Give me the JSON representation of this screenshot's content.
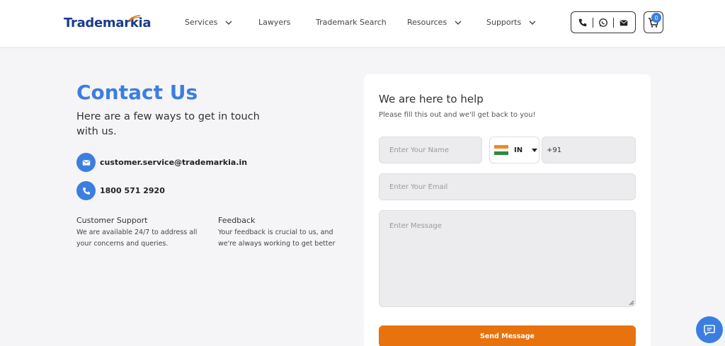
{
  "header": {
    "logo_text": "Trademarkia",
    "nav": [
      {
        "label": "Services",
        "has_dropdown": true
      },
      {
        "label": "Lawyers",
        "has_dropdown": false
      },
      {
        "label": "Trademark Search",
        "has_dropdown": false
      },
      {
        "label": "Resources",
        "has_dropdown": true
      },
      {
        "label": "Supports",
        "has_dropdown": true
      }
    ],
    "contact_icons": [
      "phone-icon",
      "whatsapp-icon",
      "mail-icon"
    ],
    "cart_icon": "cart-icon",
    "cart_count": "0"
  },
  "main": {
    "title": "Contact Us",
    "subtitle": "Here are a few ways to get in touch with us.",
    "email": "customer.service@trademarkia.in",
    "phone": "1800 571 2920",
    "support": {
      "title": "Customer Support",
      "text": "We are available 24/7 to address all your concerns and queries."
    },
    "feedback": {
      "title": "Feedback",
      "text": "Your feedback is crucial to us, and we're always working to get better"
    }
  },
  "form": {
    "title": "We are here to help",
    "subtitle": "Please fill this out and we'll get back to you!",
    "name_placeholder": "Enter Your Name",
    "country_code": "IN",
    "dial_code": "+91",
    "email_placeholder": "Enter Your Email",
    "message_placeholder": "Enter Message",
    "submit_label": "Send Message"
  },
  "colors": {
    "accent": "#3b7ee0",
    "button": "#e8730e",
    "logo": "#1a3c8c"
  }
}
